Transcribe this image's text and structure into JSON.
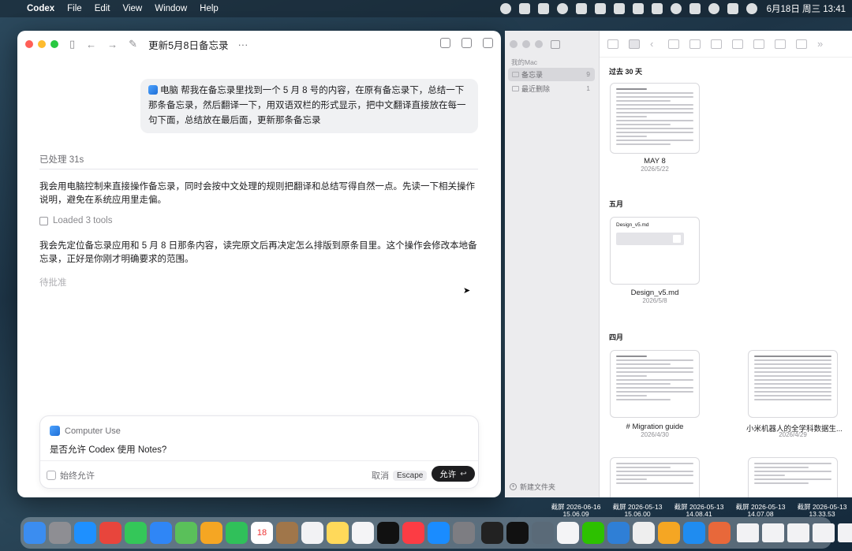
{
  "menubar": {
    "app_name": "Codex",
    "menus": [
      "File",
      "Edit",
      "View",
      "Window",
      "Help"
    ],
    "clock": "6月18日 周三  13:41"
  },
  "codex": {
    "thread_title": "更新5月8日备忘录",
    "more": "···",
    "user_message_tag": "电脑",
    "user_message": "帮我在备忘录里找到一个 5 月 8 号的内容，在原有备忘录下，总结一下那条备忘录，然后翻译一下，用双语双栏的形式显示，把中文翻译直接放在每一句下面，总结放在最后面，更新那条备忘录",
    "processed": "已处理 31s",
    "assistant_para1": "我会用电脑控制来直接操作备忘录，同时会按中文处理的规则把翻译和总结写得自然一点。先读一下相关操作说明，避免在系统应用里走偏。",
    "loaded_tools": "Loaded 3 tools",
    "assistant_para2": "我会先定位备忘录应用和 5 月 8 日那条内容，读完原文后再决定怎么排版到原条目里。这个操作会修改本地备忘录，正好是你刚才明确要求的范围。",
    "pending": "待批准",
    "approval": {
      "source": "Computer Use",
      "question": "是否允许 Codex 使用 Notes?",
      "always_allow": "始终允许",
      "cancel": "取消",
      "cancel_key": "Escape",
      "allow": "允许",
      "allow_key": "↩"
    }
  },
  "notes": {
    "sidebar_section": "我的Mac",
    "folders": [
      {
        "name": "备忘录",
        "count": "9"
      },
      {
        "name": "最近删除",
        "count": "1"
      }
    ],
    "new_folder": "新建文件夹",
    "groups": [
      {
        "month": "过去 30 天",
        "notes": [
          {
            "title": "MAY 8",
            "date": "2026/5/22"
          }
        ]
      },
      {
        "month": "五月",
        "notes": [
          {
            "title": "Design_v5.md",
            "date": "2026/5/8"
          }
        ]
      },
      {
        "month": "四月",
        "notes": [
          {
            "title": "# Migration guide",
            "date": "2026/4/30"
          },
          {
            "title": "小米机器人的全学科数据生...",
            "date": "2026/4/29"
          }
        ]
      }
    ],
    "design_thumb_title": "Design_v5.md"
  },
  "desktop_shots": [
    {
      "line1": "截屏 2026-06-16",
      "line2": "15.06.09"
    },
    {
      "line1": "截屏 2026-05-13",
      "line2": "15.06.00"
    },
    {
      "line1": "截屏 2026-05-13",
      "line2": "14.08.41"
    },
    {
      "line1": "截屏 2026-05-13",
      "line2": "14.07.08"
    },
    {
      "line1": "截屏 2026-05-13",
      "line2": "13.33.53"
    }
  ],
  "dock_apps": [
    "finder-icon",
    "launchpad-icon",
    "safari-icon",
    "chrome-icon",
    "messages-icon",
    "mail-icon",
    "maps-icon",
    "photos-icon",
    "facetime-icon",
    "calendar-icon",
    "notes-folder-icon",
    "reminders-icon",
    "notes-icon",
    "freeform-icon",
    "appletv-icon",
    "music-icon",
    "appstore-icon",
    "settings-icon",
    "terminal-icon",
    "kimi-icon",
    "browser-icon",
    "chatgpt-icon",
    "wechat-icon",
    "vscode-icon",
    "clock-icon",
    "weather-icon",
    "qq-icon",
    "claude-icon"
  ],
  "calendar_day": "18"
}
